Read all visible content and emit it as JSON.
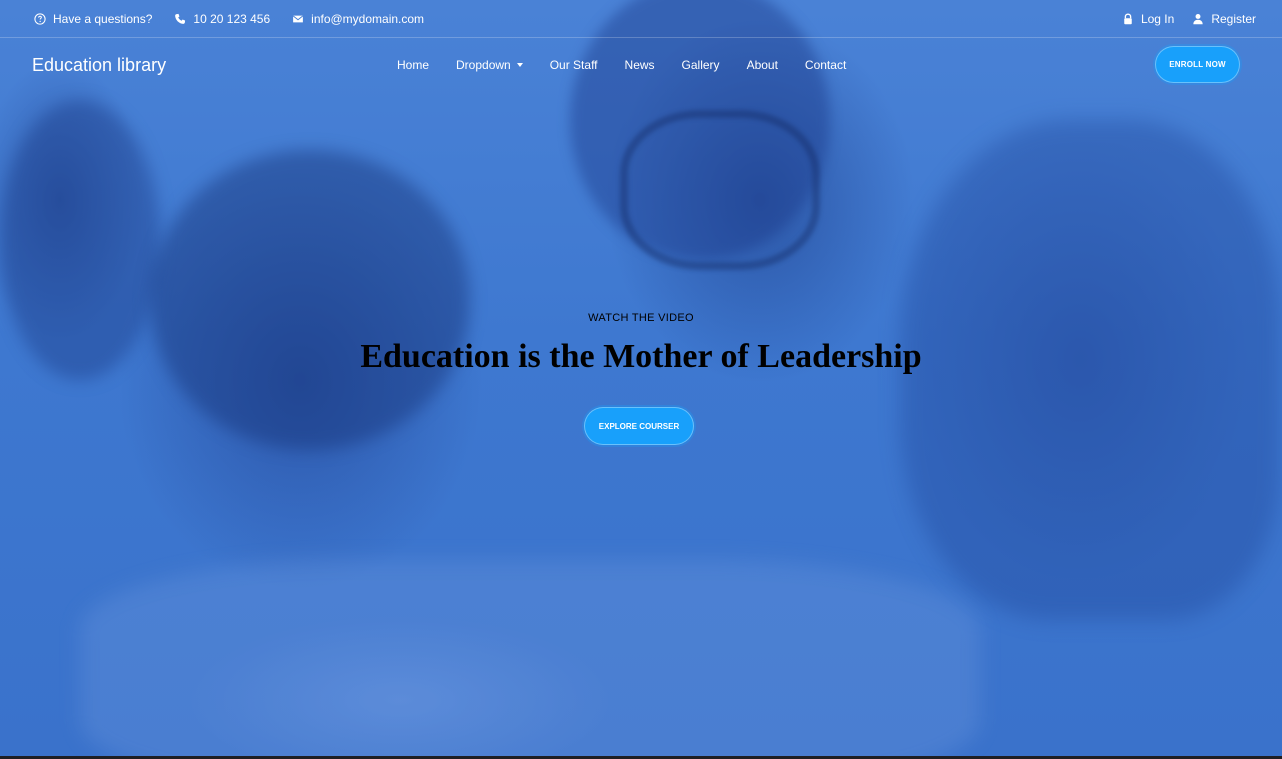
{
  "topbar": {
    "question": "Have a questions?",
    "phone": "10 20 123 456",
    "email": "info@mydomain.com",
    "login": "Log In",
    "register": "Register"
  },
  "nav": {
    "brand": "Education library",
    "items": [
      {
        "label": "Home"
      },
      {
        "label": "Dropdown"
      },
      {
        "label": "Our Staff"
      },
      {
        "label": "News"
      },
      {
        "label": "Gallery"
      },
      {
        "label": "About"
      },
      {
        "label": "Contact"
      }
    ],
    "enroll": "ENROLL NOW"
  },
  "hero": {
    "kicker": "WATCH THE VIDEO",
    "headline": "Education is the Mother of Leadership",
    "button": "EXPLORE COURSER"
  },
  "colors": {
    "overlay": "#3e78d0",
    "button": "#18a0fb",
    "text": "#ffffff"
  },
  "icons": {
    "question": "question-circle-icon",
    "phone": "phone-icon",
    "email": "envelope-icon",
    "login": "lock-icon",
    "register": "user-icon",
    "dropdown": "caret-down-icon"
  }
}
